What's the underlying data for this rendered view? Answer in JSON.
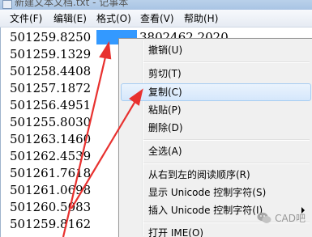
{
  "window": {
    "title": "新建文本文档.txt - 记事本"
  },
  "menubar": {
    "items": [
      {
        "label": "文件(F)"
      },
      {
        "label": "编辑(E)"
      },
      {
        "label": "格式(O)"
      },
      {
        "label": "查看(V)"
      },
      {
        "label": "帮助(H)"
      }
    ]
  },
  "editor": {
    "lines": [
      "501259.8250",
      "501259.1329",
      "501258.4408",
      "501257.1872",
      "501256.4951",
      "501255.8030",
      "501263.1460",
      "501262.4539",
      "501261.7618",
      "501261.0698",
      "501260.5083",
      "501259.8162"
    ],
    "line1_trailing": "3802462.2020"
  },
  "context_menu": {
    "items": [
      {
        "label": "撤销(U)"
      },
      {
        "label": "剪切(T)"
      },
      {
        "label": "复制(C)"
      },
      {
        "label": "粘贴(P)"
      },
      {
        "label": "删除(D)"
      },
      {
        "label": "全选(A)"
      },
      {
        "label": "从右到左的阅读顺序(R)"
      },
      {
        "label": "显示 Unicode 控制字符(S)"
      },
      {
        "label": "插入 Unicode 控制字符(I)"
      },
      {
        "label": "打开 IME(O)"
      }
    ],
    "highlighted": "复制(C)",
    "accent_color": "#3399ff"
  },
  "annotations": {
    "arrow_color": "#e8312f"
  },
  "watermark": {
    "text": "CAD吧"
  }
}
